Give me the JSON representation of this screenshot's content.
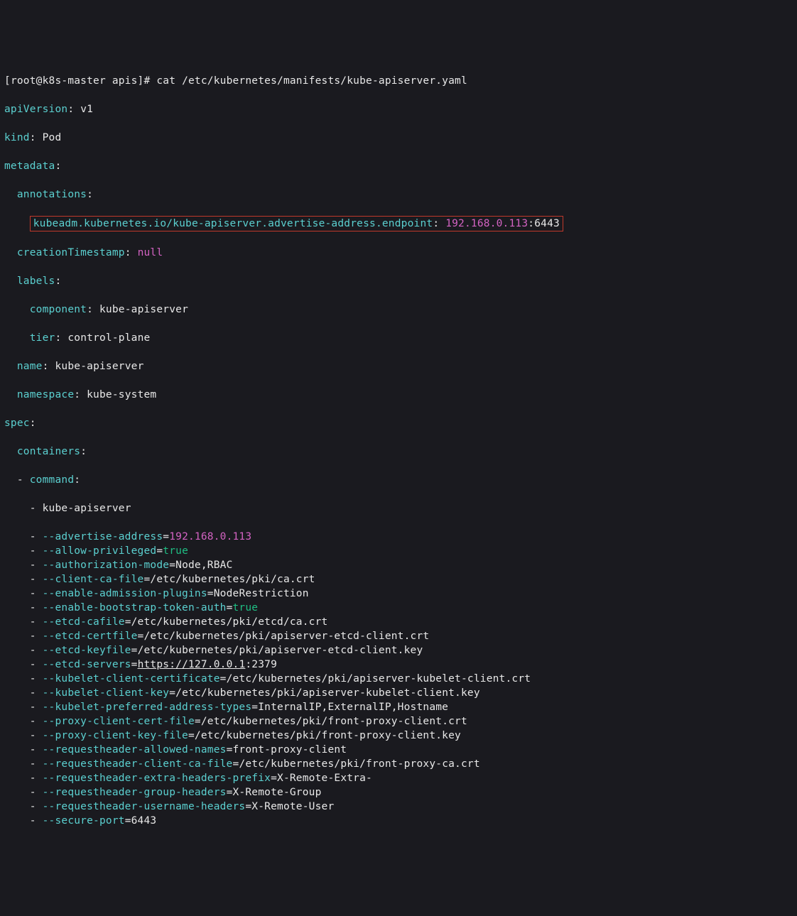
{
  "prompt": {
    "bracket_open": "[",
    "user_host": "root@k8s-master apis",
    "bracket_close": "]# ",
    "command": "cat /etc/kubernetes/manifests/kube-apiserver.yaml"
  },
  "header": {
    "apiVersionKey": "apiVersion",
    "apiVersionSep": ": ",
    "apiVersionVal": "v1",
    "kindKey": "kind",
    "kindSep": ": ",
    "kindVal": "Pod",
    "metadataKey": "metadata",
    "metadataSep": ":",
    "ind1": "  ",
    "annotationsKey": "annotations",
    "annotationsSep": ":"
  },
  "annotation_box": {
    "indent": "    ",
    "key": "kubeadm.kubernetes.io/kube-apiserver.advertise-address.endpoint",
    "sep": ": ",
    "ip": "192.168.0.113",
    "port": ":6443"
  },
  "meta2": {
    "ind1": "  ",
    "ctKey": "creationTimestamp",
    "sep": ": ",
    "ctVal": "null",
    "labelsKey": "labels",
    "colon": ":",
    "ind2": "    ",
    "compKey": "component",
    "compVal": "kube-apiserver",
    "tierKey": "tier",
    "tierVal": "control-plane",
    "nameKey": "name",
    "nameVal": "kube-apiserver",
    "nsKey": "namespace",
    "nsVal": "kube-system"
  },
  "spec": {
    "key": "spec",
    "colon": ":",
    "ind1": "  ",
    "containersKey": "containers",
    "dash": "- ",
    "commandKey": "command",
    "indCmd": "    ",
    "dash2": "- ",
    "line0": "kube-apiserver"
  },
  "flags": [
    {
      "flag": "--advertise-address",
      "eq": "=",
      "valClass": "pink",
      "val": "192.168.0.113"
    },
    {
      "flag": "--allow-privileged",
      "eq": "=",
      "valClass": "green",
      "val": "true"
    },
    {
      "flag": "--authorization-mode",
      "eq": "=",
      "valClass": "white",
      "val": "Node,RBAC"
    },
    {
      "flag": "--client-ca-file",
      "eq": "=",
      "valClass": "white",
      "val": "/etc/kubernetes/pki/ca.crt"
    },
    {
      "flag": "--enable-admission-plugins",
      "eq": "=",
      "valClass": "white",
      "val": "NodeRestriction"
    },
    {
      "flag": "--enable-bootstrap-token-auth",
      "eq": "=",
      "valClass": "green",
      "val": "true"
    },
    {
      "flag": "--etcd-cafile",
      "eq": "=",
      "valClass": "white",
      "val": "/etc/kubernetes/pki/etcd/ca.crt"
    },
    {
      "flag": "--etcd-certfile",
      "eq": "=",
      "valClass": "white",
      "val": "/etc/kubernetes/pki/apiserver-etcd-client.crt"
    },
    {
      "flag": "--etcd-keyfile",
      "eq": "=",
      "valClass": "white",
      "val": "/etc/kubernetes/pki/apiserver-etcd-client.key"
    },
    {
      "flag": "--etcd-servers",
      "eq": "=",
      "valClass": "white",
      "val": ":2379",
      "ul": "https://127.0.0.1"
    },
    {
      "flag": "--kubelet-client-certificate",
      "eq": "=",
      "valClass": "white",
      "val": "/etc/kubernetes/pki/apiserver-kubelet-client.crt"
    },
    {
      "flag": "--kubelet-client-key",
      "eq": "=",
      "valClass": "white",
      "val": "/etc/kubernetes/pki/apiserver-kubelet-client.key"
    },
    {
      "flag": "--kubelet-preferred-address-types",
      "eq": "=",
      "valClass": "white",
      "val": "InternalIP,ExternalIP,Hostname"
    },
    {
      "flag": "--proxy-client-cert-file",
      "eq": "=",
      "valClass": "white",
      "val": "/etc/kubernetes/pki/front-proxy-client.crt"
    },
    {
      "flag": "--proxy-client-key-file",
      "eq": "=",
      "valClass": "white",
      "val": "/etc/kubernetes/pki/front-proxy-client.key"
    },
    {
      "flag": "--requestheader-allowed-names",
      "eq": "=",
      "valClass": "white",
      "val": "front-proxy-client"
    },
    {
      "flag": "--requestheader-client-ca-file",
      "eq": "=",
      "valClass": "white",
      "val": "/etc/kubernetes/pki/front-proxy-ca.crt"
    },
    {
      "flag": "--requestheader-extra-headers-prefix",
      "eq": "=",
      "valClass": "white",
      "val": "X-Remote-Extra-"
    },
    {
      "flag": "--requestheader-group-headers",
      "eq": "=",
      "valClass": "white",
      "val": "X-Remote-Group"
    },
    {
      "flag": "--requestheader-username-headers",
      "eq": "=",
      "valClass": "white",
      "val": "X-Remote-User"
    },
    {
      "flag": "--secure-port",
      "eq": "=",
      "valClass": "white",
      "val": "6443"
    }
  ]
}
